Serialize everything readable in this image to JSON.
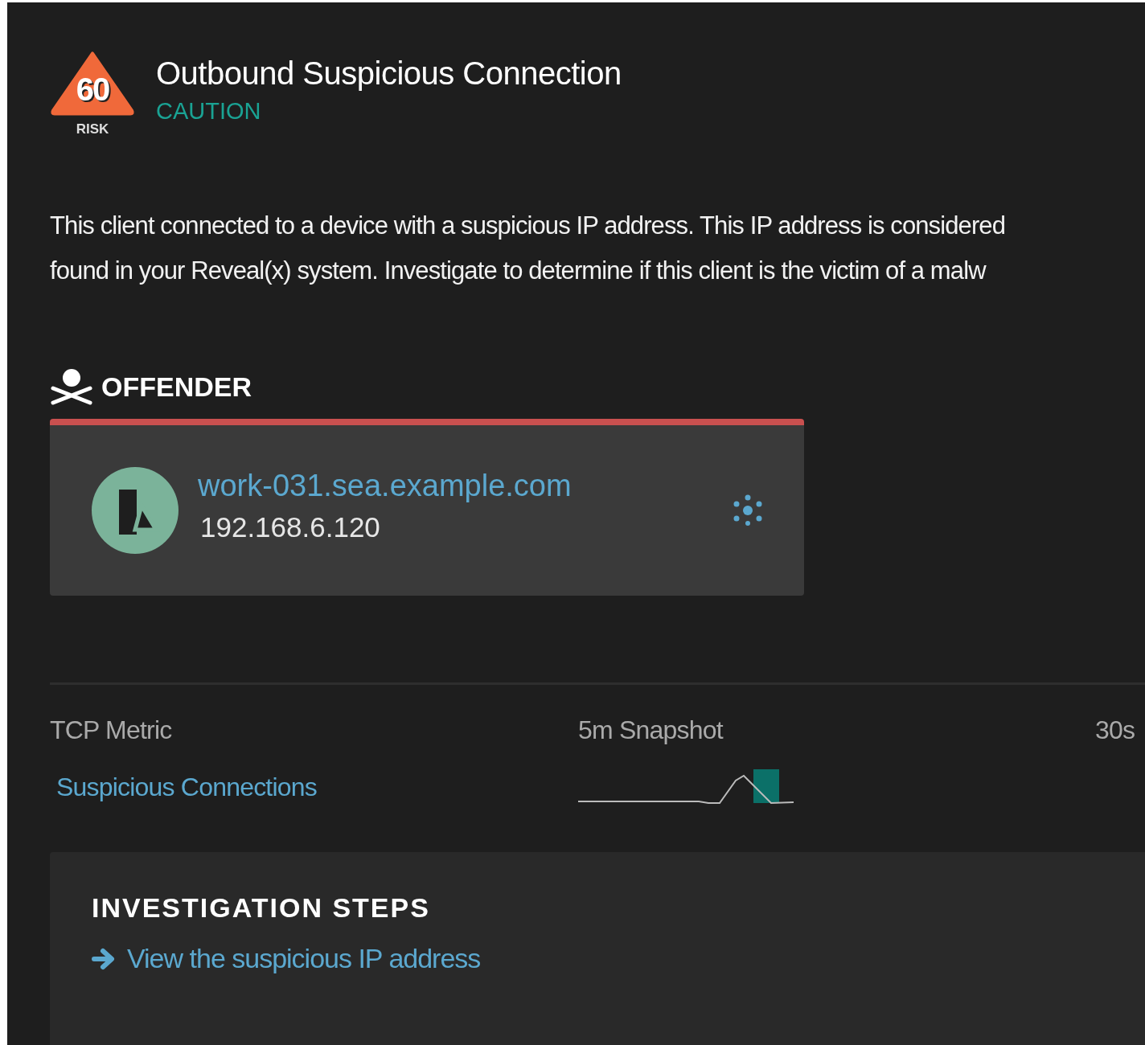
{
  "header": {
    "risk_score": "60",
    "risk_label": "RISK",
    "title": "Outbound Suspicious Connection",
    "severity": "CAUTION"
  },
  "description": [
    "This client connected to a device with a suspicious IP address. This IP address is considered",
    "found in your Reveal(x) system. Investigate to determine if this client is the victim of a malw"
  ],
  "offender": {
    "heading": "OFFENDER",
    "hostname": "work-031.sea.example.com",
    "ip": "192.168.6.120"
  },
  "metrics": {
    "columns": [
      "TCP Metric",
      "5m Snapshot",
      "30s"
    ],
    "rows": [
      {
        "name": "Suspicious Connections"
      }
    ]
  },
  "investigation": {
    "heading": "INVESTIGATION STEPS",
    "steps": [
      "View the suspicious IP address"
    ]
  }
}
